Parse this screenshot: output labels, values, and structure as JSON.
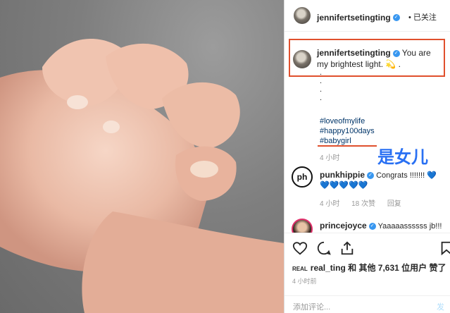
{
  "post": {
    "username": "jenniferts​etingting",
    "follow_label": "• 已关注",
    "caption_text": "You are my brightest light. 💫 .",
    "dots": [
      ".",
      ".",
      ".",
      "."
    ],
    "hashtags": [
      "#loveofmylife",
      "#happy100days",
      "#babygirl"
    ],
    "caption_time": "4 小时",
    "annotation": "是女儿"
  },
  "comments": [
    {
      "avatar_text": "ph",
      "username": "punkhippie",
      "text": "Congrats !!!!!!! 💙 💙💙💙💙💙",
      "time": "4 小时",
      "likes": "18 次赞",
      "reply": "回复"
    },
    {
      "username": "princejoyce",
      "text": "Yaaaaassssss jb!!!"
    }
  ],
  "footer": {
    "likes_logo": "REAL",
    "likes_text": "real_ting 和 其他 7,631 位用户 赞了",
    "time": "4 小时前",
    "comment_placeholder": "添加评论...",
    "post_label": "发布"
  }
}
